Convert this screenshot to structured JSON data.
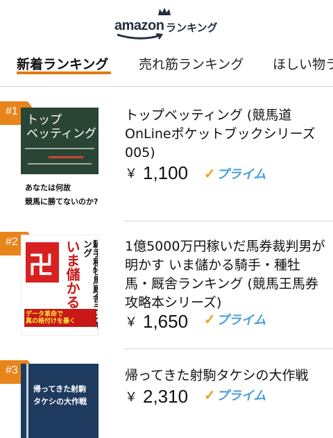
{
  "header": {
    "logo_text": "amazon",
    "logo_subtitle": "ランキング"
  },
  "tabs": [
    {
      "label": "新着ランキング",
      "active": true
    },
    {
      "label": "売れ筋ランキング",
      "active": false
    },
    {
      "label": "ほしい物ランキング",
      "active": false
    }
  ],
  "colors": {
    "accent": "#e8841a",
    "prime_blue": "#4a9fd8",
    "prime_check": "#f0a020"
  },
  "items": [
    {
      "rank": "#1",
      "title": "トップベッティング (競馬道OnLineポケットブックシリーズ005)",
      "currency": "￥",
      "price": "1,100",
      "prime_label": "プライム",
      "cover": {
        "title_lines": [
          "トップ",
          "ベッティング"
        ],
        "subtitle_lines": [
          "あなたは何故",
          "競馬に勝てないのか?"
        ]
      }
    },
    {
      "rank": "#2",
      "title": "1億5000万円稼いだ馬券裁判男が明かす いま儲かる騎手・種牡馬・厩舎ランキング (競馬王馬券攻略本シリーズ)",
      "currency": "￥",
      "price": "1,650",
      "prime_label": "プライム",
      "cover": {
        "symbol": "卍",
        "vertical_main": "いま儲かる",
        "vertical_sub": "騎手種牡馬厩舎ランキング",
        "strip_lines": [
          "データ革命で",
          "真の格付けを暴く"
        ]
      }
    },
    {
      "rank": "#3",
      "title": "帰ってきた射駒タケシの大作戦",
      "currency": "￥",
      "price": "2,310",
      "prime_label": "プライム",
      "cover": {
        "title_lines": [
          "帰ってきた射駒",
          "タケシの大作戦"
        ]
      }
    }
  ]
}
